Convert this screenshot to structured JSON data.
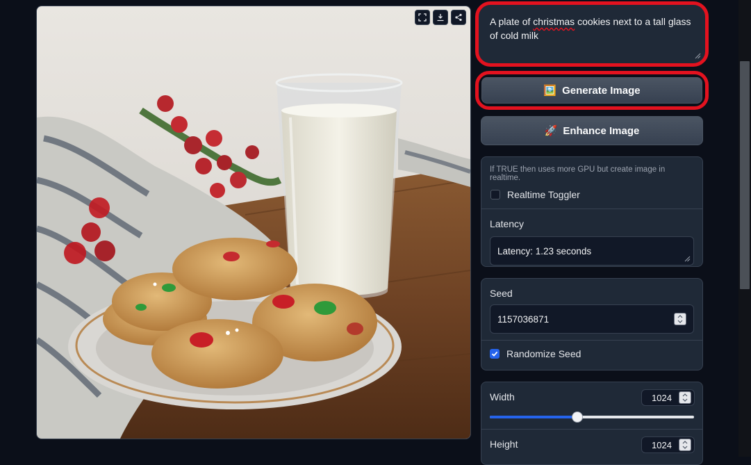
{
  "prompt": {
    "text_before": "A plate of ",
    "text_misspelled": "christmas",
    "text_after": " cookies next to a tall glass of cold milk"
  },
  "buttons": {
    "generate_icon": "🖼️",
    "generate_label": "Generate Image",
    "enhance_icon": "🚀",
    "enhance_label": "Enhance Image"
  },
  "realtime": {
    "info": "If TRUE then uses more GPU but create image in realtime.",
    "label": "Realtime Toggler",
    "checked": false
  },
  "latency": {
    "label": "Latency",
    "value": "Latency: 1.23 seconds"
  },
  "seed": {
    "label": "Seed",
    "value": "1157036871",
    "randomize_label": "Randomize Seed",
    "randomize_checked": true
  },
  "width": {
    "label": "Width",
    "value": "1024",
    "slider_fraction": 0.43
  },
  "height": {
    "label": "Height",
    "value": "1024"
  },
  "image_toolbar": [
    "fullscreen-icon",
    "download-icon",
    "share-icon"
  ],
  "colors": {
    "accent": "#2563eb",
    "highlight": "#e3121f",
    "background": "#0b0f19",
    "panel": "#1f2937"
  }
}
